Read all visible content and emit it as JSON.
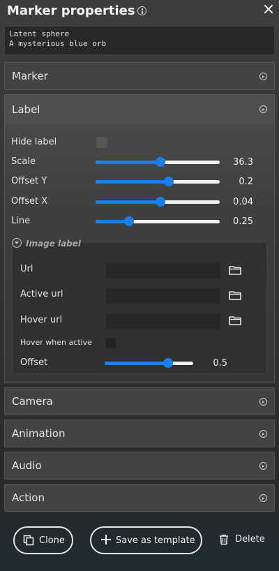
{
  "window": {
    "title": "Marker properties"
  },
  "description": {
    "text": "Latent sphere\nA mysterious blue orb"
  },
  "sections": {
    "marker": "Marker",
    "label": "Label",
    "camera": "Camera",
    "animation": "Animation",
    "audio": "Audio",
    "action": "Action"
  },
  "label_section": {
    "hide_label": "Hide label",
    "scale": {
      "label": "Scale",
      "value": "36.3",
      "fraction": 0.52
    },
    "offset_y": {
      "label": "Offset Y",
      "value": "0.2",
      "fraction": 0.59
    },
    "offset_x": {
      "label": "Offset X",
      "value": "0.04",
      "fraction": 0.52
    },
    "line": {
      "label": "Line",
      "value": "0.25",
      "fraction": 0.27
    }
  },
  "image_label": {
    "title": "Image label",
    "url": "Url",
    "active_url": "Active url",
    "hover_url": "Hover url",
    "hover_when_active": "Hover when active",
    "offset": {
      "label": "Offset",
      "value": "0.5",
      "fraction": 0.72
    }
  },
  "footer": {
    "clone": "Clone",
    "save_template": "Save as template",
    "delete": "Delete"
  },
  "colors": {
    "accent": "#1a7fe6"
  }
}
